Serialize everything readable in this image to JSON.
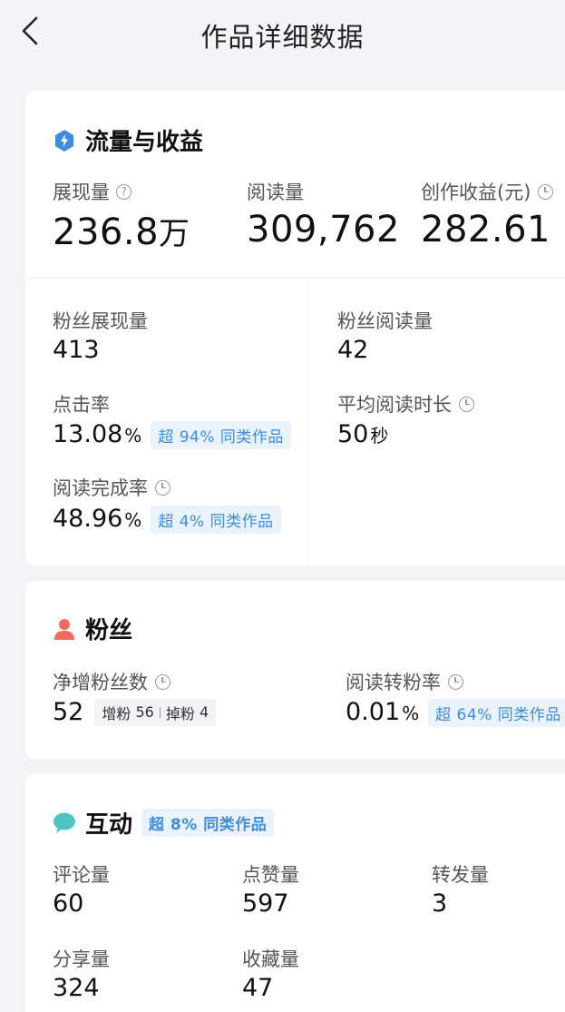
{
  "header": {
    "title": "作品详细数据"
  },
  "traffic": {
    "title": "流量与收益",
    "impressions": {
      "label": "展现量",
      "value": "236.8",
      "unit": "万"
    },
    "reads": {
      "label": "阅读量",
      "value": "309,762"
    },
    "income": {
      "label": "创作收益(元)",
      "value": "282.61"
    },
    "fan_impressions": {
      "label": "粉丝展现量",
      "value": "413"
    },
    "fan_reads": {
      "label": "粉丝阅读量",
      "value": "42"
    },
    "ctr": {
      "label": "点击率",
      "value": "13.08",
      "unit": "%",
      "badge": "超 94% 同类作品"
    },
    "avg_read_time": {
      "label": "平均阅读时长",
      "value": "50",
      "unit": "秒"
    },
    "completion": {
      "label": "阅读完成率",
      "value": "48.96",
      "unit": "%",
      "badge": "超 4% 同类作品"
    }
  },
  "fans": {
    "title": "粉丝",
    "net_gain": {
      "label": "净增粉丝数",
      "value": "52",
      "gain_label": "增粉",
      "gain": "56",
      "loss_label": "掉粉",
      "loss": "4"
    },
    "conversion": {
      "label": "阅读转粉率",
      "value": "0.01",
      "unit": "%",
      "badge": "超 64% 同类作品"
    }
  },
  "interaction": {
    "title": "互动",
    "badge": "超 8% 同类作品",
    "comments": {
      "label": "评论量",
      "value": "60"
    },
    "likes": {
      "label": "点赞量",
      "value": "597"
    },
    "forwards": {
      "label": "转发量",
      "value": "3"
    },
    "shares": {
      "label": "分享量",
      "value": "324"
    },
    "favorites": {
      "label": "收藏量",
      "value": "47"
    }
  },
  "colors": {
    "accent_blue": "#3b8ce2",
    "fans_red": "#ef6b5d",
    "chat_teal": "#4ec5c1",
    "badge_bg": "#eaf3fd"
  },
  "icons": {
    "back": "chevron-left-icon",
    "traffic": "lightning-icon",
    "fans": "person-icon",
    "interaction": "chat-bubble-icon"
  }
}
